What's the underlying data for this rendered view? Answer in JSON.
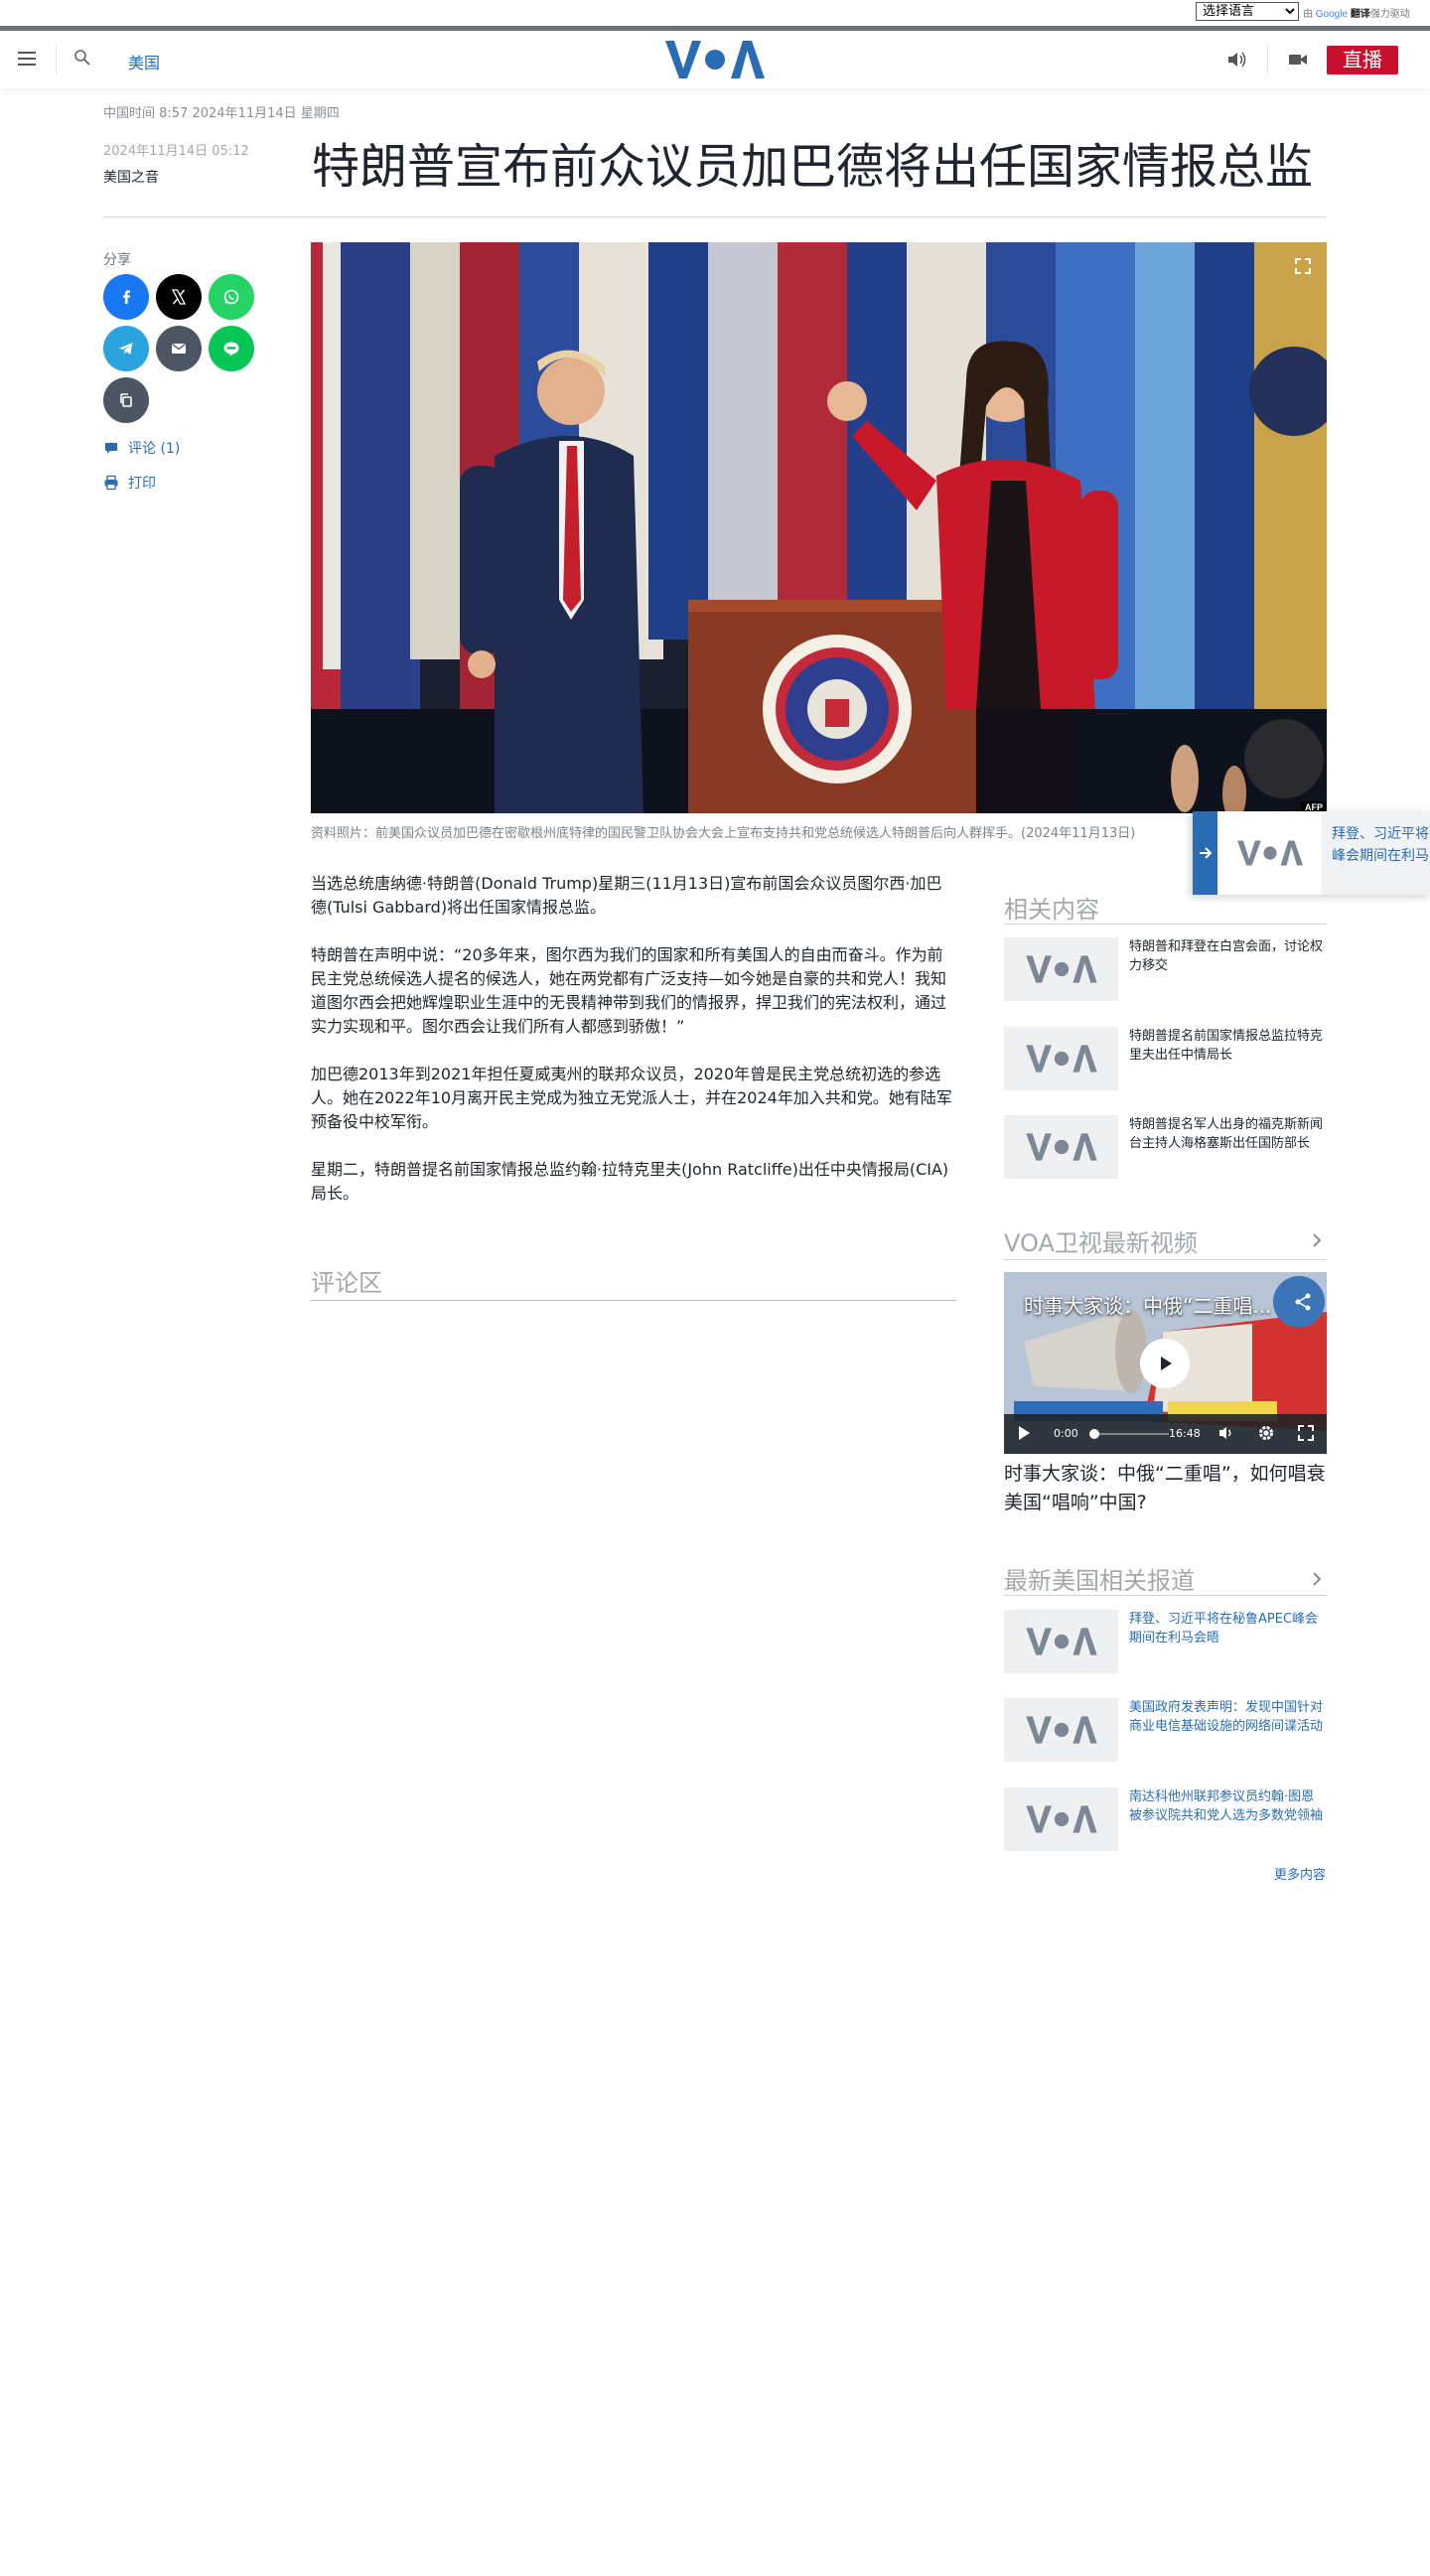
{
  "translate_bar": {
    "select_value": "选择语言",
    "options": [
      "选择语言"
    ],
    "credit_prefix": "由",
    "credit_brand": "Google",
    "credit_word": "翻译",
    "credit_suffix": "强力驱动"
  },
  "header": {
    "section": "美国",
    "logo_text": "VOA",
    "live_label": "直播"
  },
  "article": {
    "local_time": "中国时间 8:57 2024年11月14日 星期四",
    "published": "2024年11月14日 05:12",
    "author": "美国之音",
    "headline": "特朗普宣布前众议员加巴德将出任国家情报总监",
    "photo_credit": "AFP",
    "caption": "资料照片：前美国众议员加巴德在密歇根州底特律的国民警卫队协会大会上宣布支持共和党总统候选人特朗普后向人群挥手。(2024年11月13日)",
    "paragraphs": [
      "当选总统唐纳德·特朗普(Donald Trump)星期三(11月13日)宣布前国会众议员图尔西·加巴德(Tulsi Gabbard)将出任国家情报总监。",
      "特朗普在声明中说：“20多年来，图尔西为我们的国家和所有美国人的自由而奋斗。作为前民主党总统候选人提名的候选人，她在两党都有广泛支持—如今她是自豪的共和党人！我知道图尔西会把她辉煌职业生涯中的无畏精神带到我们的情报界，捍卫我们的宪法权利，通过实力实现和平。图尔西会让我们所有人都感到骄傲！”",
      "加巴德2013年到2021年担任夏威夷州的联邦众议员，2020年曾是民主党总统初选的参选人。她在2022年10月离开民主党成为独立无党派人士，并在2024年加入共和党。她有陆军预备役中校军衔。",
      "星期二，特朗普提名前国家情报总监约翰·拉特克里夫(John Ratcliffe)出任中央情报局(CIA)局长。"
    ],
    "comments_title": "评论区"
  },
  "share": {
    "label": "分享",
    "comments_link": "评论 (1)",
    "print_link": "打印",
    "colors": {
      "facebook": "#1877f2",
      "x": "#000000",
      "whatsapp": "#25d366",
      "telegram": "#2aa3de",
      "email": "#4b5563",
      "line": "#06c755",
      "copy": "#4b5563"
    }
  },
  "sidebar": {
    "related": {
      "title": "相关内容",
      "items": [
        {
          "title": "特朗普和拜登在白宫会面，讨论权力移交"
        },
        {
          "title": "特朗普提名前国家情报总监拉特克里夫出任中情局长"
        },
        {
          "title": "特朗普提名军人出身的福克斯新闻台主持人海格塞斯出任国防部长"
        }
      ]
    },
    "video": {
      "section_title": "VOA卫视最新视频",
      "overlay_title": "时事大家谈：中俄“二重唱...",
      "current_time": "0:00",
      "duration": "16:48",
      "progress": 0,
      "caption": "时事大家谈：中俄“二重唱”，如何唱衰美国“唱响”中国?"
    },
    "latest": {
      "title": "最新美国相关报道",
      "items": [
        {
          "title": "拜登、习近平将在秘鲁APEC峰会期间在利马会晤"
        },
        {
          "title": "美国政府发表声明：发现中国针对商业电信基础设施的网络间谍活动"
        },
        {
          "title": "南达科他州联邦参议员约翰·图恩被参议院共和党人选为多数党领袖"
        }
      ],
      "more_link": "更多内容"
    }
  },
  "floating_card": {
    "text_line1": "拜登、习近平将",
    "text_line2": "峰会期间在利马"
  },
  "colors": {
    "accent_blue": "#2a6cb3",
    "live_red": "#c8102e",
    "text_dark": "#1f2530",
    "muted_gray": "#a4a8ae"
  }
}
